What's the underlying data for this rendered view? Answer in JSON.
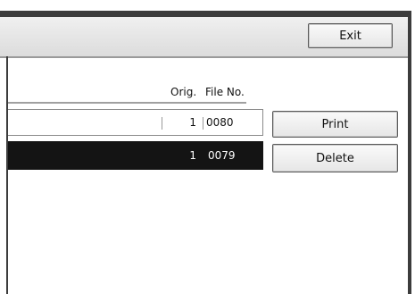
{
  "toolbar": {
    "exit_label": "Exit"
  },
  "table": {
    "columns": [
      "Orig.",
      "File No."
    ],
    "rows": [
      {
        "orig": "1",
        "file_no": "0080",
        "selected": false
      },
      {
        "orig": "1",
        "file_no": "0079",
        "selected": true
      }
    ]
  },
  "actions": {
    "print_label": "Print",
    "delete_label": "Delete"
  }
}
